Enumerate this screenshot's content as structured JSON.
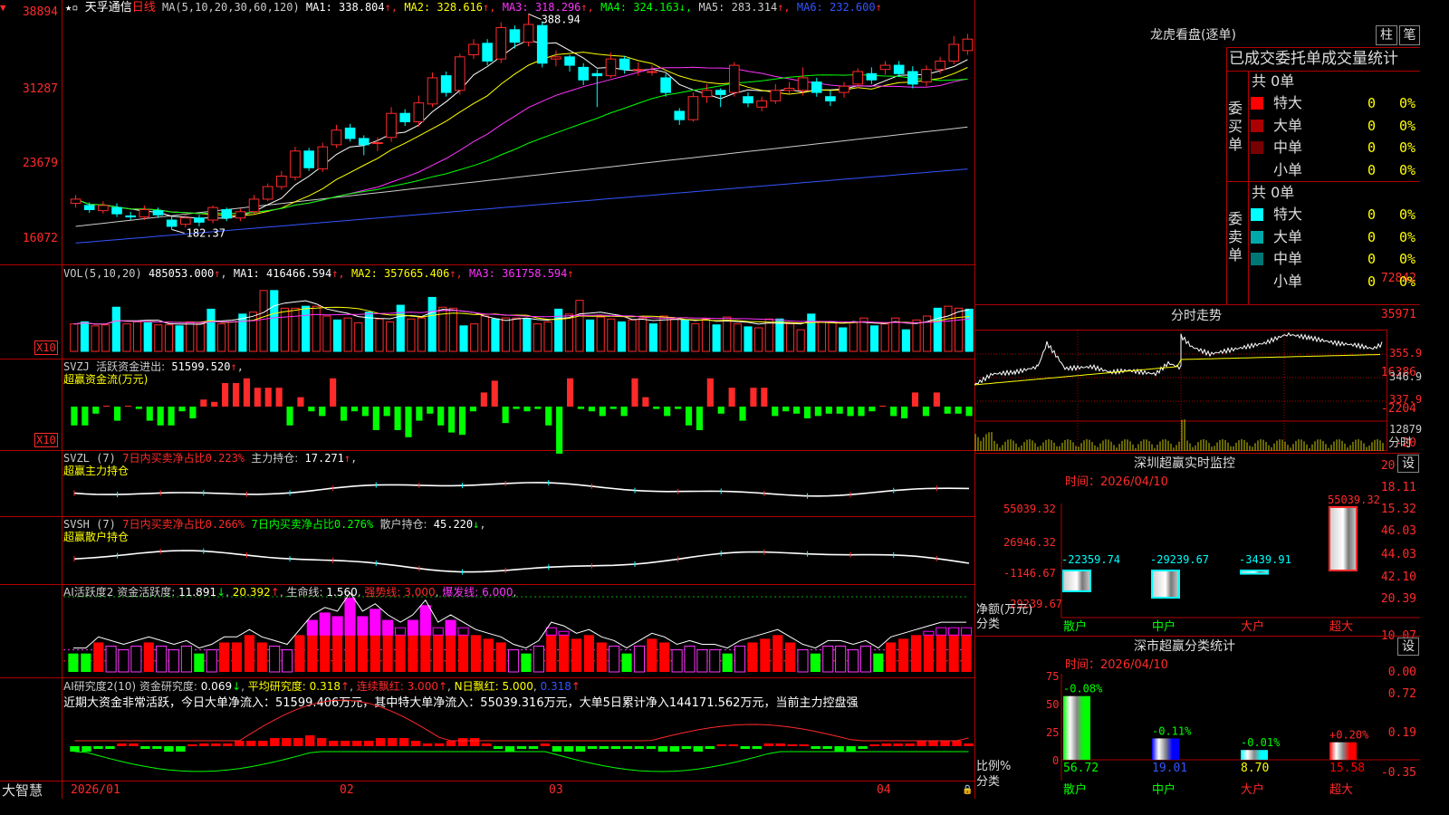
{
  "stock": {
    "name": "天孚通信",
    "period": "日线"
  },
  "kline": {
    "ma_params": "MA(5,10,20,30,60,120)",
    "ma": [
      {
        "name": "MA1",
        "value": "338.804",
        "arrow": "↑",
        "color": "#ffffff"
      },
      {
        "name": "MA2",
        "value": "328.616",
        "arrow": "↑",
        "color": "#ffff00"
      },
      {
        "name": "MA3",
        "value": "318.296",
        "arrow": "↑",
        "color": "#ff33ff"
      },
      {
        "name": "MA4",
        "value": "324.163",
        "arrow": "↓",
        "color": "#00ff00"
      },
      {
        "name": "MA5",
        "value": "283.314",
        "arrow": "↑",
        "color": "#cccccc"
      },
      {
        "name": "MA6",
        "value": "232.600",
        "arrow": "↑",
        "color": "#3355ff"
      }
    ],
    "y_labels": [
      "38894",
      "31287",
      "23679",
      "16072"
    ],
    "ylim": [
      16072,
      38894
    ],
    "high_label": "388.94",
    "low_label": "182.37",
    "candles": [
      {
        "o": 20.8,
        "c": 21.2,
        "h": 21.6,
        "l": 20.4
      },
      {
        "o": 20.6,
        "c": 20.2,
        "h": 20.9,
        "l": 19.9
      },
      {
        "o": 20.1,
        "c": 20.6,
        "h": 21.0,
        "l": 19.8
      },
      {
        "o": 20.4,
        "c": 19.8,
        "h": 20.8,
        "l": 19.5
      },
      {
        "o": 19.6,
        "c": 19.5,
        "h": 20.0,
        "l": 19.2
      },
      {
        "o": 19.5,
        "c": 20.2,
        "h": 20.6,
        "l": 19.2
      },
      {
        "o": 20.1,
        "c": 19.7,
        "h": 20.4,
        "l": 19.4
      },
      {
        "o": 19.2,
        "c": 18.6,
        "h": 19.5,
        "l": 18.3
      },
      {
        "o": 18.8,
        "c": 19.4,
        "h": 19.8,
        "l": 18.5
      },
      {
        "o": 19.4,
        "c": 19.0,
        "h": 19.7,
        "l": 18.6
      },
      {
        "o": 19.2,
        "c": 20.4,
        "h": 20.6,
        "l": 18.9
      },
      {
        "o": 20.2,
        "c": 19.4,
        "h": 20.4,
        "l": 19.1
      },
      {
        "o": 19.4,
        "c": 20.0,
        "h": 20.3,
        "l": 19.1
      },
      {
        "o": 20.0,
        "c": 21.2,
        "h": 21.6,
        "l": 19.8
      },
      {
        "o": 21.2,
        "c": 22.4,
        "h": 22.7,
        "l": 21.0
      },
      {
        "o": 22.4,
        "c": 23.4,
        "h": 23.9,
        "l": 22.1
      },
      {
        "o": 23.3,
        "c": 25.8,
        "h": 26.2,
        "l": 23.0
      },
      {
        "o": 25.8,
        "c": 24.2,
        "h": 26.1,
        "l": 23.9
      },
      {
        "o": 24.1,
        "c": 26.2,
        "h": 26.6,
        "l": 23.8
      },
      {
        "o": 26.4,
        "c": 27.8,
        "h": 28.3,
        "l": 26.1
      },
      {
        "o": 28.0,
        "c": 27.0,
        "h": 28.4,
        "l": 26.7
      },
      {
        "o": 27.0,
        "c": 26.4,
        "h": 27.3,
        "l": 25.4
      },
      {
        "o": 26.6,
        "c": 26.6,
        "h": 27.1,
        "l": 25.8
      },
      {
        "o": 27.1,
        "c": 29.4,
        "h": 30.0,
        "l": 26.7
      },
      {
        "o": 29.4,
        "c": 28.6,
        "h": 29.8,
        "l": 28.2
      },
      {
        "o": 28.6,
        "c": 30.4,
        "h": 31.1,
        "l": 28.1
      },
      {
        "o": 30.3,
        "c": 32.8,
        "h": 33.3,
        "l": 30.0
      },
      {
        "o": 33.0,
        "c": 31.4,
        "h": 33.4,
        "l": 31.0
      },
      {
        "o": 31.6,
        "c": 34.8,
        "h": 35.1,
        "l": 31.2
      },
      {
        "o": 35.0,
        "c": 36.0,
        "h": 36.5,
        "l": 34.6
      },
      {
        "o": 36.1,
        "c": 34.4,
        "h": 36.5,
        "l": 34.0
      },
      {
        "o": 34.6,
        "c": 37.6,
        "h": 38.1,
        "l": 34.2
      },
      {
        "o": 37.4,
        "c": 36.2,
        "h": 37.8,
        "l": 35.6
      },
      {
        "o": 36.2,
        "c": 37.9,
        "h": 38.9,
        "l": 35.8
      },
      {
        "o": 37.8,
        "c": 34.2,
        "h": 38.2,
        "l": 33.8
      },
      {
        "o": 34.6,
        "c": 34.8,
        "h": 35.4,
        "l": 33.9
      },
      {
        "o": 34.8,
        "c": 34.0,
        "h": 35.0,
        "l": 33.4
      },
      {
        "o": 33.8,
        "c": 32.6,
        "h": 34.2,
        "l": 32.1
      },
      {
        "o": 33.2,
        "c": 33.0,
        "h": 33.6,
        "l": 30.0
      },
      {
        "o": 33.0,
        "c": 34.6,
        "h": 35.2,
        "l": 32.8
      },
      {
        "o": 34.6,
        "c": 33.6,
        "h": 34.9,
        "l": 33.2
      },
      {
        "o": 33.6,
        "c": 33.6,
        "h": 34.3,
        "l": 33.0
      },
      {
        "o": 33.4,
        "c": 33.4,
        "h": 34.0,
        "l": 33.0
      },
      {
        "o": 32.8,
        "c": 31.4,
        "h": 33.2,
        "l": 31.0
      },
      {
        "o": 29.6,
        "c": 28.8,
        "h": 29.9,
        "l": 28.3
      },
      {
        "o": 28.8,
        "c": 31.0,
        "h": 31.4,
        "l": 28.6
      },
      {
        "o": 31.0,
        "c": 31.6,
        "h": 32.2,
        "l": 30.4
      },
      {
        "o": 31.6,
        "c": 31.2,
        "h": 31.8,
        "l": 30.0
      },
      {
        "o": 31.4,
        "c": 34.0,
        "h": 34.3,
        "l": 31.0
      },
      {
        "o": 31.0,
        "c": 30.4,
        "h": 31.4,
        "l": 30.0
      },
      {
        "o": 30.0,
        "c": 30.6,
        "h": 31.0,
        "l": 29.6
      },
      {
        "o": 30.6,
        "c": 31.6,
        "h": 32.2,
        "l": 30.3
      },
      {
        "o": 31.6,
        "c": 31.8,
        "h": 32.4,
        "l": 31.3
      },
      {
        "o": 31.6,
        "c": 32.8,
        "h": 33.8,
        "l": 31.1
      },
      {
        "o": 32.4,
        "c": 31.4,
        "h": 32.8,
        "l": 31.0
      },
      {
        "o": 31.0,
        "c": 30.6,
        "h": 31.6,
        "l": 30.1
      },
      {
        "o": 31.4,
        "c": 32.0,
        "h": 32.4,
        "l": 30.9
      },
      {
        "o": 32.2,
        "c": 33.4,
        "h": 33.7,
        "l": 31.8
      },
      {
        "o": 33.2,
        "c": 32.6,
        "h": 33.8,
        "l": 32.2
      },
      {
        "o": 33.6,
        "c": 34.0,
        "h": 34.4,
        "l": 33.1
      },
      {
        "o": 34.0,
        "c": 33.2,
        "h": 34.4,
        "l": 32.9
      },
      {
        "o": 33.4,
        "c": 32.2,
        "h": 33.9,
        "l": 31.8
      },
      {
        "o": 32.4,
        "c": 33.6,
        "h": 34.0,
        "l": 32.0
      },
      {
        "o": 33.6,
        "c": 34.4,
        "h": 34.8,
        "l": 33.2
      },
      {
        "o": 34.4,
        "c": 36.0,
        "h": 36.8,
        "l": 34.1
      },
      {
        "o": 35.4,
        "c": 36.5,
        "h": 37.0,
        "l": 35.0
      }
    ]
  },
  "vol": {
    "title": "VOL(5,10,20)",
    "value": "485053.000",
    "arrow": "↑",
    "ma": [
      {
        "name": "MA1",
        "value": "416466.594",
        "arrow": "↑",
        "color": "#ffffff"
      },
      {
        "name": "MA2",
        "value": "357665.406",
        "arrow": "↑",
        "color": "#ffff00"
      },
      {
        "name": "MA3",
        "value": "361758.594",
        "arrow": "↑",
        "color": "#ff33ff"
      }
    ],
    "y_labels": [
      "72842",
      "35971"
    ],
    "scale_label": "X10",
    "values": [
      28,
      30,
      26,
      27,
      45,
      28,
      30,
      29,
      27,
      27,
      26,
      30,
      28,
      43,
      28,
      30,
      38,
      40,
      62,
      62,
      44,
      44,
      46,
      46,
      36,
      32,
      34,
      29,
      40,
      33,
      30,
      47,
      33,
      34,
      55,
      45,
      44,
      26,
      28,
      36,
      33,
      34,
      34,
      33,
      28,
      30,
      43,
      38,
      52,
      32,
      35,
      33,
      30,
      32,
      34,
      28,
      36,
      33,
      32,
      28,
      33,
      27,
      35,
      28,
      25,
      24,
      33,
      33,
      28,
      22,
      38,
      30,
      30,
      24,
      30,
      34,
      26,
      28,
      34,
      22,
      32,
      36,
      44,
      46,
      44,
      43
    ]
  },
  "svzj": {
    "title": "SVZJ",
    "sub": "活跃资金进出:",
    "value": "51599.520",
    "arrow": "↑",
    "label": "超赢资金流(万元)",
    "y_labels": [
      "16386",
      "-2204",
      "-20"
    ],
    "scale_label": "X10",
    "values": [
      -8,
      -8,
      -3,
      0,
      -6,
      0,
      -1,
      -6,
      -8,
      -8,
      -2,
      -5,
      3,
      2,
      10,
      10,
      12,
      8,
      8,
      8,
      -8,
      4,
      -2,
      -4,
      12,
      -6,
      -2,
      -4,
      -10,
      -4,
      -10,
      -13,
      -6,
      -3,
      -8,
      -11,
      -12,
      -2,
      6,
      11,
      -7,
      -1,
      -2,
      -1,
      -8,
      -20,
      12,
      -1,
      -2,
      -4,
      -1,
      -4,
      12,
      4,
      -1,
      -4,
      -1,
      -8,
      -10,
      12,
      -3,
      8,
      -6,
      8,
      8,
      -4,
      -2,
      -3,
      -5,
      -4,
      -3,
      -3,
      -4,
      -4,
      -2,
      0,
      -4,
      -5,
      6,
      -4,
      6,
      -3,
      -3,
      -4
    ]
  },
  "svzl": {
    "title": "SVZL (7)",
    "p1": "7日内买卖净占比",
    "p1v": "0.223%",
    "p2": "主力持仓:",
    "p2v": "17.271",
    "arrow": "↑",
    "label": "超赢主力持仓",
    "y_labels": [
      "20.90",
      "18.11",
      "15.32"
    ]
  },
  "svsh": {
    "title": "SVSH (7)",
    "p1": "7日内买卖净占比",
    "p1v": "0.266%",
    "p2": "7日内买卖净占比",
    "p2v": "0.276%",
    "p3": "散户持仓:",
    "p3v": "45.220",
    "arrow": "↓",
    "label": "超赢散户持仓",
    "y_labels": [
      "46.03",
      "44.03",
      "42.10"
    ]
  },
  "ai1": {
    "title": "AI活跃度2",
    "sub": "资金活跃度:",
    "v1": "11.891",
    "a1": "↓",
    "v2": "20.392",
    "a2": "↑",
    "life": "生命线:",
    "v3": "1.560",
    "strong": "强势线:",
    "v4": "3.000",
    "burst": "爆发线:",
    "v5": "6.000",
    "y_labels": [
      "20.39",
      "10.07",
      "0.00"
    ],
    "values": [
      5,
      5,
      8,
      7,
      6,
      7,
      8,
      7,
      6,
      7,
      5,
      6,
      8,
      8,
      10,
      8,
      7,
      6,
      10,
      14,
      16,
      15,
      20,
      15,
      17,
      14,
      12,
      14,
      18,
      12,
      14,
      12,
      10,
      9,
      8,
      6,
      5,
      7,
      12,
      11,
      9,
      10,
      8,
      7,
      5,
      7,
      9,
      8,
      6,
      7,
      6,
      6,
      5,
      7,
      8,
      9,
      10,
      8,
      6,
      5,
      7,
      7,
      6,
      7,
      5,
      8,
      9,
      10,
      11,
      12,
      12,
      12
    ]
  },
  "ai2": {
    "title": "AI研究度2(10)",
    "sub": "资金研究度:",
    "v1": "0.069",
    "a1": "↓",
    "avg": "平均研究度:",
    "v2": "0.318",
    "a2": "↑",
    "streak": "连续飘红:",
    "v3": "3.000",
    "a3": "↑",
    "nday": "N日飘红:",
    "v4": "5.000",
    "v5": "0.318",
    "a5": "↑",
    "y_labels": [
      "0.72",
      "0.19",
      "-0.35"
    ],
    "note": "近期大资金非常活跃，今日大单净流入：51599.406万元，其中特大单净流入：55039.316万元，大单5日累计净入144171.562万元，当前主力控盘强",
    "values": [
      -2,
      -2,
      -1,
      -1,
      1,
      1,
      -1,
      -1,
      -2,
      -2,
      0,
      1,
      1,
      1,
      2,
      2,
      2,
      3,
      3,
      3,
      4,
      3,
      2,
      2,
      2,
      2,
      3,
      3,
      3,
      2,
      1,
      1,
      2,
      3,
      3,
      1,
      -1,
      -2,
      -1,
      -1,
      1,
      -2,
      -2,
      -2,
      -1,
      -1,
      -1,
      -1,
      -1,
      -1,
      -2,
      -2,
      -1,
      -2,
      -1,
      0,
      0,
      -1,
      -1,
      1,
      1,
      0,
      0,
      -1,
      -1,
      -2,
      -2,
      -1,
      0,
      1,
      1,
      1,
      2,
      2,
      2,
      2,
      1
    ]
  },
  "xaxis": {
    "brand": "大智慧",
    "labels": [
      "2026/01",
      "02",
      "03",
      "04"
    ]
  },
  "lhb": {
    "title": "龙虎看盘(逐单)",
    "btn1": "柱",
    "btn2": "笔",
    "header": "已成交委托单成交量统计",
    "buy": {
      "side": "委买单",
      "total": "共 0单",
      "rows": [
        {
          "name": "特大",
          "color": "#ff0000",
          "count": "0",
          "pct": "0%"
        },
        {
          "name": "大单",
          "color": "#aa0000",
          "count": "0",
          "pct": "0%"
        },
        {
          "name": "中单",
          "color": "#770000",
          "count": "0",
          "pct": "0%"
        },
        {
          "name": "小单",
          "color": "#000000",
          "count": "0",
          "pct": "0%"
        }
      ]
    },
    "sell": {
      "side": "委卖单",
      "total": "共 0单",
      "rows": [
        {
          "name": "特大",
          "color": "#00ffff",
          "count": "0",
          "pct": "0%"
        },
        {
          "name": "大单",
          "color": "#00aaaa",
          "count": "0",
          "pct": "0%"
        },
        {
          "name": "中单",
          "color": "#007777",
          "count": "0",
          "pct": "0%"
        },
        {
          "name": "小单",
          "color": "#000000",
          "count": "0",
          "pct": "0%"
        }
      ]
    }
  },
  "fenshi": {
    "title": "分时走势",
    "y_labels": [
      "355.9",
      "346.9",
      "337.9"
    ],
    "vol_label": "12879",
    "vol_tag": "分时"
  },
  "szjk": {
    "title": "深圳超赢实时监控",
    "btn": "设",
    "time": "时间：2026/04/10",
    "y_labels": [
      "55039.32",
      "26946.32",
      "-1146.67",
      "-29239.67"
    ],
    "ylabel1": "净额(万元)",
    "ylabel2": "分类",
    "bars": [
      {
        "cat": "散户",
        "value": -22359.74,
        "label": "-22359.74"
      },
      {
        "cat": "中户",
        "value": -29239.67,
        "label": "-29239.67"
      },
      {
        "cat": "大户",
        "value": -3439.91,
        "label": "-3439.91"
      },
      {
        "cat": "超大",
        "value": 55039.32,
        "label": "55039.32"
      }
    ]
  },
  "sstj": {
    "title": "深市超赢分类统计",
    "btn": "设",
    "time": "时间：2026/04/10",
    "y_labels": [
      "75",
      "50",
      "25",
      "0"
    ],
    "ylabel1": "比例%",
    "ylabel2": "分类",
    "bars": [
      {
        "cat": "散户",
        "value": 56.72,
        "label": "56.72",
        "change": "-0.08%",
        "color": "#00ff00",
        "ccolor": "#00ff00"
      },
      {
        "cat": "中户",
        "value": 19.01,
        "label": "19.01",
        "change": "-0.11%",
        "color": "#0000ff",
        "ccolor": "#00ff00"
      },
      {
        "cat": "大户",
        "value": 8.7,
        "label": "8.70",
        "change": "-0.01%",
        "color": "#00ffff",
        "ccolor": "#00ff00"
      },
      {
        "cat": "超大",
        "value": 15.58,
        "label": "15.58",
        "change": "+0.20%",
        "color": "#ff0000",
        "ccolor": "#ff2a2a"
      }
    ]
  }
}
